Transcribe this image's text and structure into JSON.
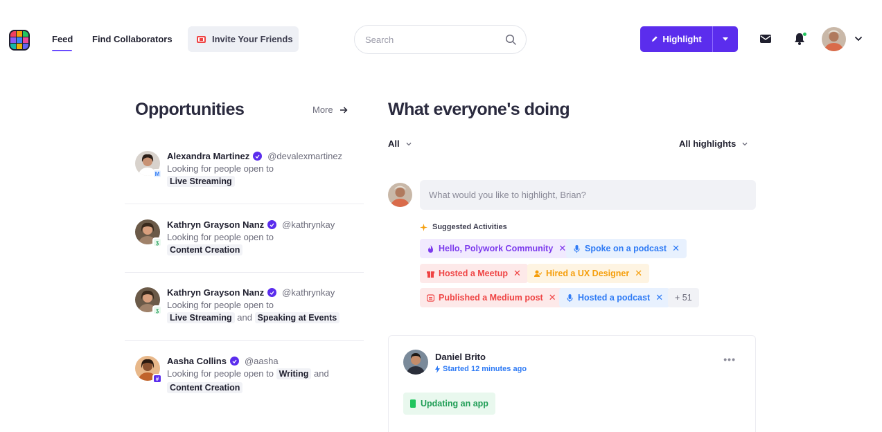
{
  "nav": {
    "feed": "Feed",
    "find_collaborators": "Find Collaborators",
    "invite": "Invite Your Friends",
    "search_placeholder": "Search",
    "highlight": "Highlight",
    "accent": "#5b2ded",
    "icons": [
      "logo-icon",
      "search-icon",
      "pen-icon",
      "chevron-down-icon",
      "mail-icon",
      "bell-icon",
      "avatar"
    ]
  },
  "opportunities": {
    "title": "Opportunities",
    "more": "More",
    "items": [
      {
        "name": "Alexandra Martinez",
        "handle": "@devalexmartinez",
        "desc": "Looking for people open to",
        "tags": [
          "Live Streaming"
        ],
        "joiner": ""
      },
      {
        "name": "Kathryn Grayson Nanz",
        "handle": "@kathrynkay",
        "desc": "Looking for people open to",
        "tags": [
          "Content Creation"
        ],
        "joiner": ""
      },
      {
        "name": "Kathryn Grayson Nanz",
        "handle": "@kathrynkay",
        "desc": "Looking for people open to",
        "tags": [
          "Live Streaming",
          "Speaking at Events"
        ],
        "joiner": "and"
      },
      {
        "name": "Aasha Collins",
        "handle": "@aasha",
        "desc": "Looking for people open to",
        "tags": [
          "Writing",
          "Content Creation"
        ],
        "joiner": "and"
      }
    ]
  },
  "feed": {
    "title": "What everyone's doing",
    "filter_all": "All",
    "filter_highlights": "All highlights",
    "composer_placeholder": "What would you like to highlight, Brian?",
    "suggested_label": "Suggested Activities",
    "chips": [
      {
        "label": "Hello, Polywork Community",
        "color": "#7c3aed",
        "bg": "#f1eafe"
      },
      {
        "label": "Spoke on a podcast",
        "color": "#2f7bf5",
        "bg": "#e8f1fe"
      },
      {
        "label": "Hosted a Meetup",
        "color": "#ef4444",
        "bg": "#fde9e9"
      },
      {
        "label": "Hired a UX Designer",
        "color": "#f59e0b",
        "bg": "#fef4e2"
      },
      {
        "label": "Published a Medium post",
        "color": "#ef4444",
        "bg": "#fde9e9"
      },
      {
        "label": "Hosted a podcast",
        "color": "#2f7bf5",
        "bg": "#e8f1fe"
      }
    ],
    "more_count": "+ 51",
    "post": {
      "author": "Daniel Brito",
      "time": "Started 12 minutes ago",
      "more": "•••",
      "activity": "Updating an app"
    }
  }
}
